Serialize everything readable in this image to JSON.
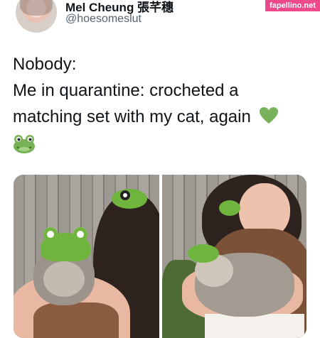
{
  "author": {
    "display_name": "Mel Cheung 張芊穗",
    "handle": "@hoesomeslut"
  },
  "watermark": "fapellino.net",
  "tweet": {
    "lines": [
      "Nobody:",
      "Me in quarantine: crocheted a",
      "matching set with my cat, again"
    ],
    "emoji": [
      "green-heart",
      "frog-face"
    ]
  },
  "colors": {
    "crochet_green": "#6fb43c",
    "heart_green": "#78b159",
    "watermark_pink": "#ee4a8b"
  },
  "media": [
    "photo-back-view-woman-and-cat-frog-hats",
    "photo-front-view-woman-smiling-holding-cat"
  ]
}
